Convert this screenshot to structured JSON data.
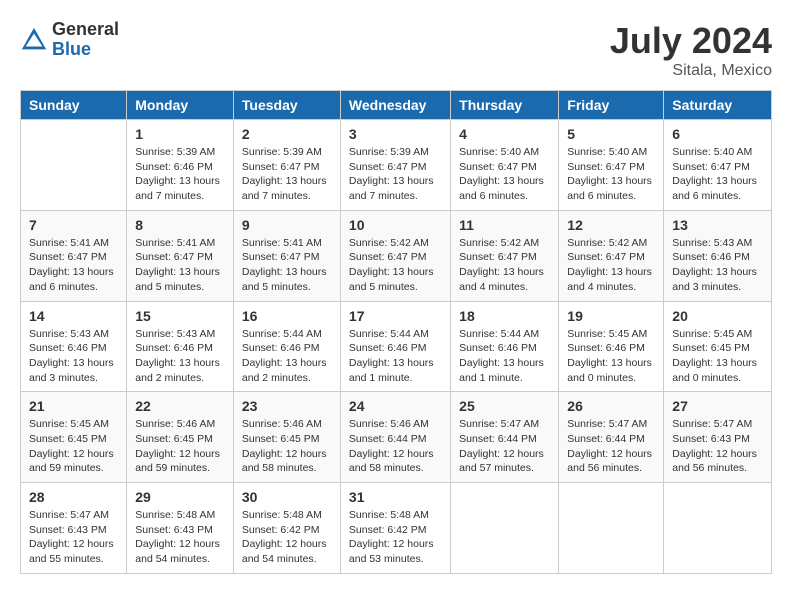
{
  "logo": {
    "general": "General",
    "blue": "Blue"
  },
  "title": "July 2024",
  "location": "Sitala, Mexico",
  "days_header": [
    "Sunday",
    "Monday",
    "Tuesday",
    "Wednesday",
    "Thursday",
    "Friday",
    "Saturday"
  ],
  "weeks": [
    [
      {
        "day": "",
        "sunrise": "",
        "sunset": "",
        "daylight": ""
      },
      {
        "day": "1",
        "sunrise": "Sunrise: 5:39 AM",
        "sunset": "Sunset: 6:46 PM",
        "daylight": "Daylight: 13 hours and 7 minutes."
      },
      {
        "day": "2",
        "sunrise": "Sunrise: 5:39 AM",
        "sunset": "Sunset: 6:47 PM",
        "daylight": "Daylight: 13 hours and 7 minutes."
      },
      {
        "day": "3",
        "sunrise": "Sunrise: 5:39 AM",
        "sunset": "Sunset: 6:47 PM",
        "daylight": "Daylight: 13 hours and 7 minutes."
      },
      {
        "day": "4",
        "sunrise": "Sunrise: 5:40 AM",
        "sunset": "Sunset: 6:47 PM",
        "daylight": "Daylight: 13 hours and 6 minutes."
      },
      {
        "day": "5",
        "sunrise": "Sunrise: 5:40 AM",
        "sunset": "Sunset: 6:47 PM",
        "daylight": "Daylight: 13 hours and 6 minutes."
      },
      {
        "day": "6",
        "sunrise": "Sunrise: 5:40 AM",
        "sunset": "Sunset: 6:47 PM",
        "daylight": "Daylight: 13 hours and 6 minutes."
      }
    ],
    [
      {
        "day": "7",
        "sunrise": "Sunrise: 5:41 AM",
        "sunset": "Sunset: 6:47 PM",
        "daylight": "Daylight: 13 hours and 6 minutes."
      },
      {
        "day": "8",
        "sunrise": "Sunrise: 5:41 AM",
        "sunset": "Sunset: 6:47 PM",
        "daylight": "Daylight: 13 hours and 5 minutes."
      },
      {
        "day": "9",
        "sunrise": "Sunrise: 5:41 AM",
        "sunset": "Sunset: 6:47 PM",
        "daylight": "Daylight: 13 hours and 5 minutes."
      },
      {
        "day": "10",
        "sunrise": "Sunrise: 5:42 AM",
        "sunset": "Sunset: 6:47 PM",
        "daylight": "Daylight: 13 hours and 5 minutes."
      },
      {
        "day": "11",
        "sunrise": "Sunrise: 5:42 AM",
        "sunset": "Sunset: 6:47 PM",
        "daylight": "Daylight: 13 hours and 4 minutes."
      },
      {
        "day": "12",
        "sunrise": "Sunrise: 5:42 AM",
        "sunset": "Sunset: 6:47 PM",
        "daylight": "Daylight: 13 hours and 4 minutes."
      },
      {
        "day": "13",
        "sunrise": "Sunrise: 5:43 AM",
        "sunset": "Sunset: 6:46 PM",
        "daylight": "Daylight: 13 hours and 3 minutes."
      }
    ],
    [
      {
        "day": "14",
        "sunrise": "Sunrise: 5:43 AM",
        "sunset": "Sunset: 6:46 PM",
        "daylight": "Daylight: 13 hours and 3 minutes."
      },
      {
        "day": "15",
        "sunrise": "Sunrise: 5:43 AM",
        "sunset": "Sunset: 6:46 PM",
        "daylight": "Daylight: 13 hours and 2 minutes."
      },
      {
        "day": "16",
        "sunrise": "Sunrise: 5:44 AM",
        "sunset": "Sunset: 6:46 PM",
        "daylight": "Daylight: 13 hours and 2 minutes."
      },
      {
        "day": "17",
        "sunrise": "Sunrise: 5:44 AM",
        "sunset": "Sunset: 6:46 PM",
        "daylight": "Daylight: 13 hours and 1 minute."
      },
      {
        "day": "18",
        "sunrise": "Sunrise: 5:44 AM",
        "sunset": "Sunset: 6:46 PM",
        "daylight": "Daylight: 13 hours and 1 minute."
      },
      {
        "day": "19",
        "sunrise": "Sunrise: 5:45 AM",
        "sunset": "Sunset: 6:46 PM",
        "daylight": "Daylight: 13 hours and 0 minutes."
      },
      {
        "day": "20",
        "sunrise": "Sunrise: 5:45 AM",
        "sunset": "Sunset: 6:45 PM",
        "daylight": "Daylight: 13 hours and 0 minutes."
      }
    ],
    [
      {
        "day": "21",
        "sunrise": "Sunrise: 5:45 AM",
        "sunset": "Sunset: 6:45 PM",
        "daylight": "Daylight: 12 hours and 59 minutes."
      },
      {
        "day": "22",
        "sunrise": "Sunrise: 5:46 AM",
        "sunset": "Sunset: 6:45 PM",
        "daylight": "Daylight: 12 hours and 59 minutes."
      },
      {
        "day": "23",
        "sunrise": "Sunrise: 5:46 AM",
        "sunset": "Sunset: 6:45 PM",
        "daylight": "Daylight: 12 hours and 58 minutes."
      },
      {
        "day": "24",
        "sunrise": "Sunrise: 5:46 AM",
        "sunset": "Sunset: 6:44 PM",
        "daylight": "Daylight: 12 hours and 58 minutes."
      },
      {
        "day": "25",
        "sunrise": "Sunrise: 5:47 AM",
        "sunset": "Sunset: 6:44 PM",
        "daylight": "Daylight: 12 hours and 57 minutes."
      },
      {
        "day": "26",
        "sunrise": "Sunrise: 5:47 AM",
        "sunset": "Sunset: 6:44 PM",
        "daylight": "Daylight: 12 hours and 56 minutes."
      },
      {
        "day": "27",
        "sunrise": "Sunrise: 5:47 AM",
        "sunset": "Sunset: 6:43 PM",
        "daylight": "Daylight: 12 hours and 56 minutes."
      }
    ],
    [
      {
        "day": "28",
        "sunrise": "Sunrise: 5:47 AM",
        "sunset": "Sunset: 6:43 PM",
        "daylight": "Daylight: 12 hours and 55 minutes."
      },
      {
        "day": "29",
        "sunrise": "Sunrise: 5:48 AM",
        "sunset": "Sunset: 6:43 PM",
        "daylight": "Daylight: 12 hours and 54 minutes."
      },
      {
        "day": "30",
        "sunrise": "Sunrise: 5:48 AM",
        "sunset": "Sunset: 6:42 PM",
        "daylight": "Daylight: 12 hours and 54 minutes."
      },
      {
        "day": "31",
        "sunrise": "Sunrise: 5:48 AM",
        "sunset": "Sunset: 6:42 PM",
        "daylight": "Daylight: 12 hours and 53 minutes."
      },
      {
        "day": "",
        "sunrise": "",
        "sunset": "",
        "daylight": ""
      },
      {
        "day": "",
        "sunrise": "",
        "sunset": "",
        "daylight": ""
      },
      {
        "day": "",
        "sunrise": "",
        "sunset": "",
        "daylight": ""
      }
    ]
  ]
}
